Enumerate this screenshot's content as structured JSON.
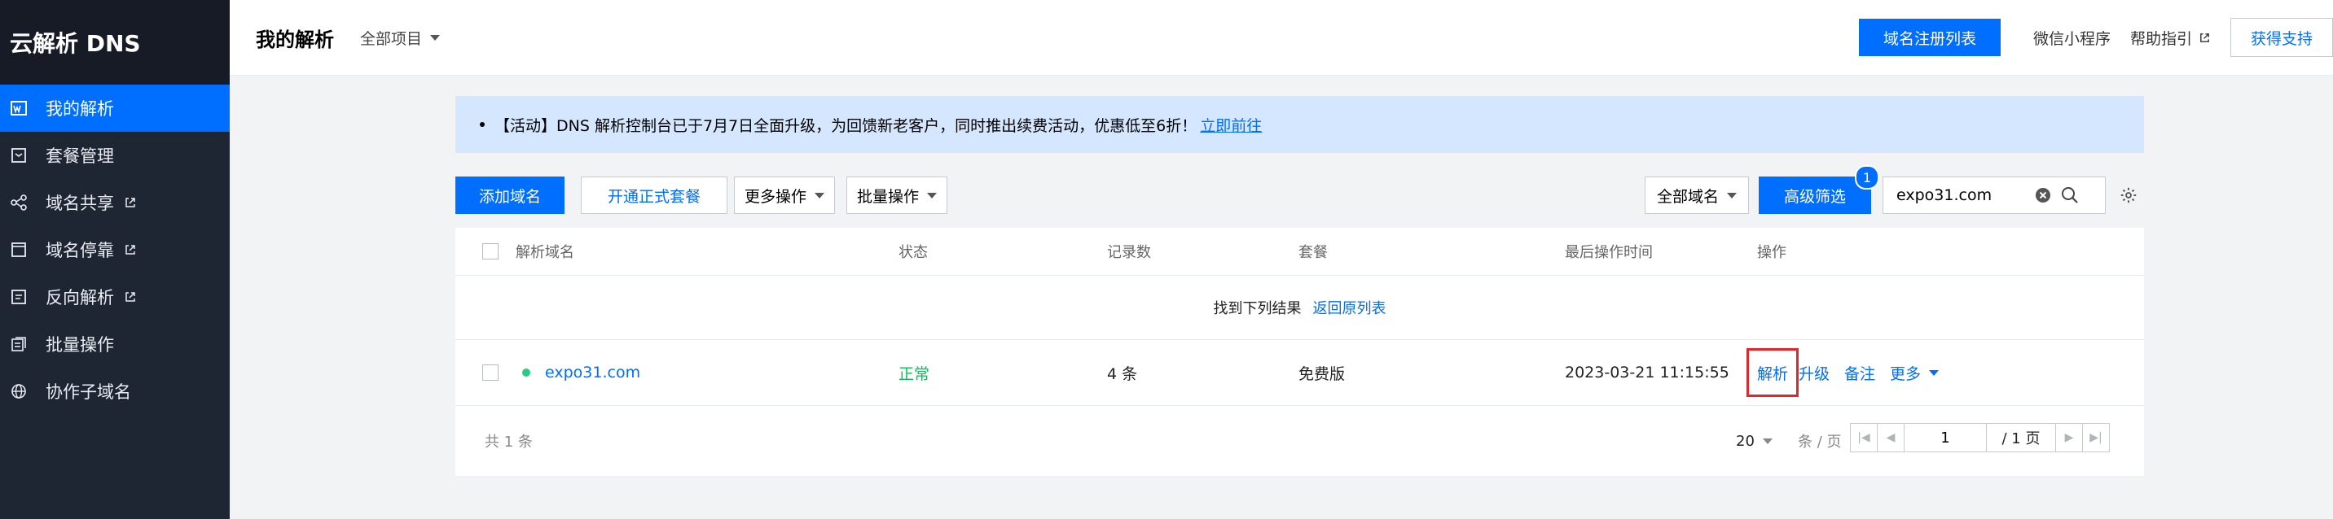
{
  "sidebar": {
    "brand": "云解析 DNS",
    "items": [
      {
        "label": "我的解析",
        "icon": "domain-icon",
        "external": false,
        "active": true
      },
      {
        "label": "套餐管理",
        "icon": "package-icon",
        "external": false,
        "active": false
      },
      {
        "label": "域名共享",
        "icon": "share-icon",
        "external": true,
        "active": false
      },
      {
        "label": "域名停靠",
        "icon": "parking-icon",
        "external": true,
        "active": false
      },
      {
        "label": "反向解析",
        "icon": "reverse-icon",
        "external": true,
        "active": false
      },
      {
        "label": "批量操作",
        "icon": "batch-icon",
        "external": false,
        "active": false
      },
      {
        "label": "协作子域名",
        "icon": "globe-icon",
        "external": false,
        "active": false
      }
    ]
  },
  "header": {
    "title": "我的解析",
    "project_select": "全部项目",
    "register_list_button": "域名注册列表",
    "wechat_link": "微信小程序",
    "help_link": "帮助指引",
    "support_button": "获得支持"
  },
  "notice": {
    "text": "【活动】DNS 解析控制台已于7月7日全面升级，为回馈新老客户，同时推出续费活动，优惠低至6折！",
    "link": "立即前往"
  },
  "toolbar": {
    "add_domain": "添加域名",
    "open_package": "开通正式套餐",
    "more_actions": "更多操作",
    "batch_actions": "批量操作",
    "domain_filter": "全部域名",
    "advanced_filter": "高级筛选",
    "advanced_filter_badge": "1",
    "search_value": "expo31.com"
  },
  "table": {
    "columns": [
      "解析域名",
      "状态",
      "记录数",
      "套餐",
      "最后操作时间",
      "操作"
    ],
    "result_text": "找到下列结果",
    "back_link": "返回原列表",
    "rows": [
      {
        "domain": "expo31.com",
        "status": "正常",
        "records": "4 条",
        "package": "免费版",
        "last_modified": "2023-03-21 11:15:55",
        "actions": {
          "resolve": "解析",
          "upgrade": "升级",
          "note": "备注",
          "more": "更多"
        }
      }
    ],
    "footer": {
      "total": "共 1 条",
      "page_size": "20",
      "page_size_unit": "条 / 页",
      "page_input": "1",
      "page_total": "/ 1 页"
    }
  },
  "colors": {
    "primary": "#006eff",
    "sidebar_bg": "#1f2633",
    "status_ok": "#0abf5b",
    "highlight": "#e5252a"
  }
}
